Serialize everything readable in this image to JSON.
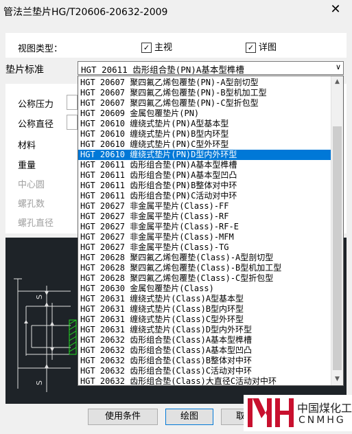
{
  "window": {
    "title": "管法兰垫片HG/T20606-20632-2009",
    "close_label": "✕"
  },
  "view_type": {
    "label": "视图类型：",
    "main_view": {
      "label": "主视",
      "checked": "✓"
    },
    "detail_view": {
      "label": "详图",
      "checked": "✓"
    }
  },
  "gasket_standard": {
    "label": "垫片标准",
    "selected_value": "HGT 20611 齿形组合垫(PN)A基本型榫槽",
    "arrow": "∨",
    "options": [
      "HGT 20607 聚四氟乙烯包覆垫(PN)-A型剖切型",
      "HGT 20607 聚四氟乙烯包覆垫(PN)-B型机加工型",
      "HGT 20607 聚四氟乙烯包覆垫(PN)-C型折包型",
      "HGT 20609 金属包覆垫片(PN)",
      "HGT 20610 缠绕式垫片(PN)A型基本型",
      "HGT 20610 缠绕式垫片(PN)B型内环型",
      "HGT 20610 缠绕式垫片(PN)C型外环型",
      "HGT 20610 缠绕式垫片(PN)D型内外环型",
      "HGT 20611 齿形组合垫(PN)A基本型榫槽",
      "HGT 20611 齿形组合垫(PN)A基本型凹凸",
      "HGT 20611 齿形组合垫(PN)B整体对中环",
      "HGT 20611 齿形组合垫(PN)C活动对中环",
      "HGT 20627 非金属平垫片(Class)-FF",
      "HGT 20627 非金属平垫片(Class)-RF",
      "HGT 20627 非金属平垫片(Class)-RF-E",
      "HGT 20627 非金属平垫片(Class)-MFM",
      "HGT 20627 非金属平垫片(Class)-TG",
      "HGT 20628 聚四氟乙烯包覆垫(Class)-A型剖切型",
      "HGT 20628 聚四氟乙烯包覆垫(Class)-B型机加工型",
      "HGT 20628 聚四氟乙烯包覆垫(Class)-C型折包型",
      "HGT 20630 金属包覆垫片(Class)",
      "HGT 20631 缠绕式垫片(Class)A型基本型",
      "HGT 20631 缠绕式垫片(Class)B型内环型",
      "HGT 20631 缠绕式垫片(Class)C型外环型",
      "HGT 20631 缠绕式垫片(Class)D型内外环型",
      "HGT 20632 齿形组合垫(Class)A基本型榫槽",
      "HGT 20632 齿形组合垫(Class)A基本型凹凸",
      "HGT 20632 齿形组合垫(Class)B整体对中环",
      "HGT 20632 齿形组合垫(Class)C活动对中环",
      "HGT 20632 齿形组合垫(Class)大直径C活动对中环"
    ],
    "highlighted_index": 7,
    "scroll_up": "▲",
    "scroll_down": "▼"
  },
  "params": {
    "nominal_pressure": "公称压力",
    "nominal_diameter": "公称直径",
    "material": "材料",
    "weight": "重量",
    "center_circle": "中心圆",
    "bolt_hole_count": "螺孔数",
    "bolt_hole_diameter": "螺孔直径"
  },
  "preview": {
    "dim_label": "S"
  },
  "buttons": {
    "use_conditions": "使用条件",
    "draw": "绘图",
    "cancel": "取消"
  },
  "logo": {
    "text_cn": "中国煤化工",
    "text_en": "CNMHG",
    "colors": {
      "brand": "#c8102e"
    }
  }
}
